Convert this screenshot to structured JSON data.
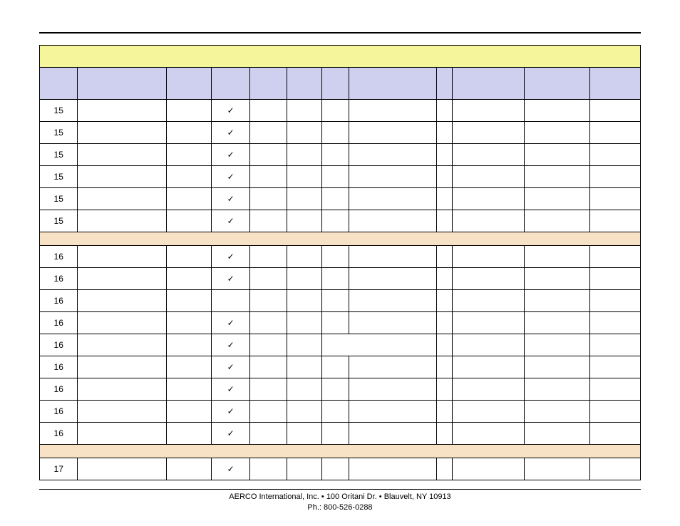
{
  "check": "✓",
  "rows": {
    "g15": [
      "15",
      "15",
      "15",
      "15",
      "15",
      "15"
    ],
    "g16": [
      "16",
      "16",
      "16",
      "16",
      "16",
      "16",
      "16",
      "16",
      "16"
    ],
    "g17": [
      "17"
    ]
  },
  "footer": {
    "line1": "AERCO International, Inc. • 100 Oritani Dr. • Blauvelt, NY 10913",
    "line2": "Ph.: 800-526-0288"
  }
}
